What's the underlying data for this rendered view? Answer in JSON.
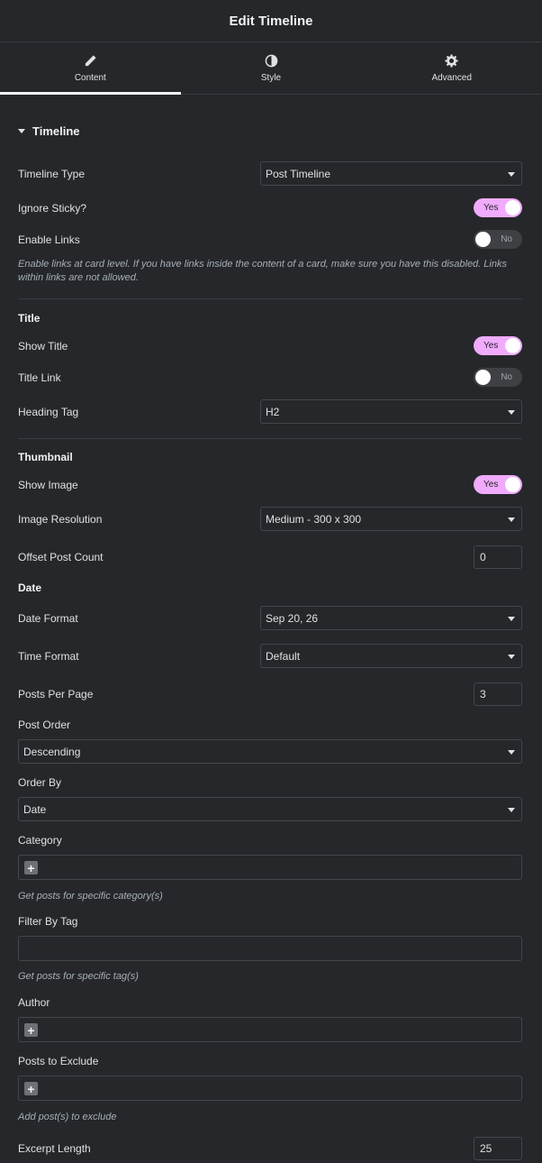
{
  "header": {
    "title": "Edit Timeline"
  },
  "tabs": [
    {
      "label": "Content",
      "icon": "pencil-icon"
    },
    {
      "label": "Style",
      "icon": "contrast-icon"
    },
    {
      "label": "Advanced",
      "icon": "gear-icon"
    }
  ],
  "section": {
    "title": "Timeline"
  },
  "fields": {
    "timeline_type": {
      "label": "Timeline Type",
      "value": "Post Timeline"
    },
    "ignore_sticky": {
      "label": "Ignore Sticky?",
      "value": "Yes"
    },
    "enable_links": {
      "label": "Enable Links",
      "value": "No",
      "description": "Enable links at card level. If you have links inside the content of a card, make sure you have this disabled. Links within links are not allowed."
    },
    "title_heading": "Title",
    "show_title": {
      "label": "Show Title",
      "value": "Yes"
    },
    "title_link": {
      "label": "Title Link",
      "value": "No"
    },
    "heading_tag": {
      "label": "Heading Tag",
      "value": "H2"
    },
    "thumbnail_heading": "Thumbnail",
    "show_image": {
      "label": "Show Image",
      "value": "Yes"
    },
    "image_resolution": {
      "label": "Image Resolution",
      "value": "Medium - 300 x 300"
    },
    "offset_post_count": {
      "label": "Offset Post Count",
      "value": "0"
    },
    "date_heading": "Date",
    "date_format": {
      "label": "Date Format",
      "value": "Sep 20, 26"
    },
    "time_format": {
      "label": "Time Format",
      "value": "Default"
    },
    "posts_per_page": {
      "label": "Posts Per Page",
      "value": "3"
    },
    "post_order": {
      "label": "Post Order",
      "value": "Descending"
    },
    "order_by": {
      "label": "Order By",
      "value": "Date"
    },
    "category": {
      "label": "Category",
      "description": "Get posts for specific category(s)"
    },
    "filter_by_tag": {
      "label": "Filter By Tag",
      "description": "Get posts for specific tag(s)"
    },
    "author": {
      "label": "Author"
    },
    "posts_to_exclude": {
      "label": "Posts to Exclude",
      "description": "Add post(s) to exclude"
    },
    "excerpt_length": {
      "label": "Excerpt Length",
      "value": "25"
    }
  },
  "colors": {
    "background": "#26272b",
    "toggle_on": "#f0abfc",
    "toggle_off": "#3f4044",
    "border": "#45464b"
  }
}
